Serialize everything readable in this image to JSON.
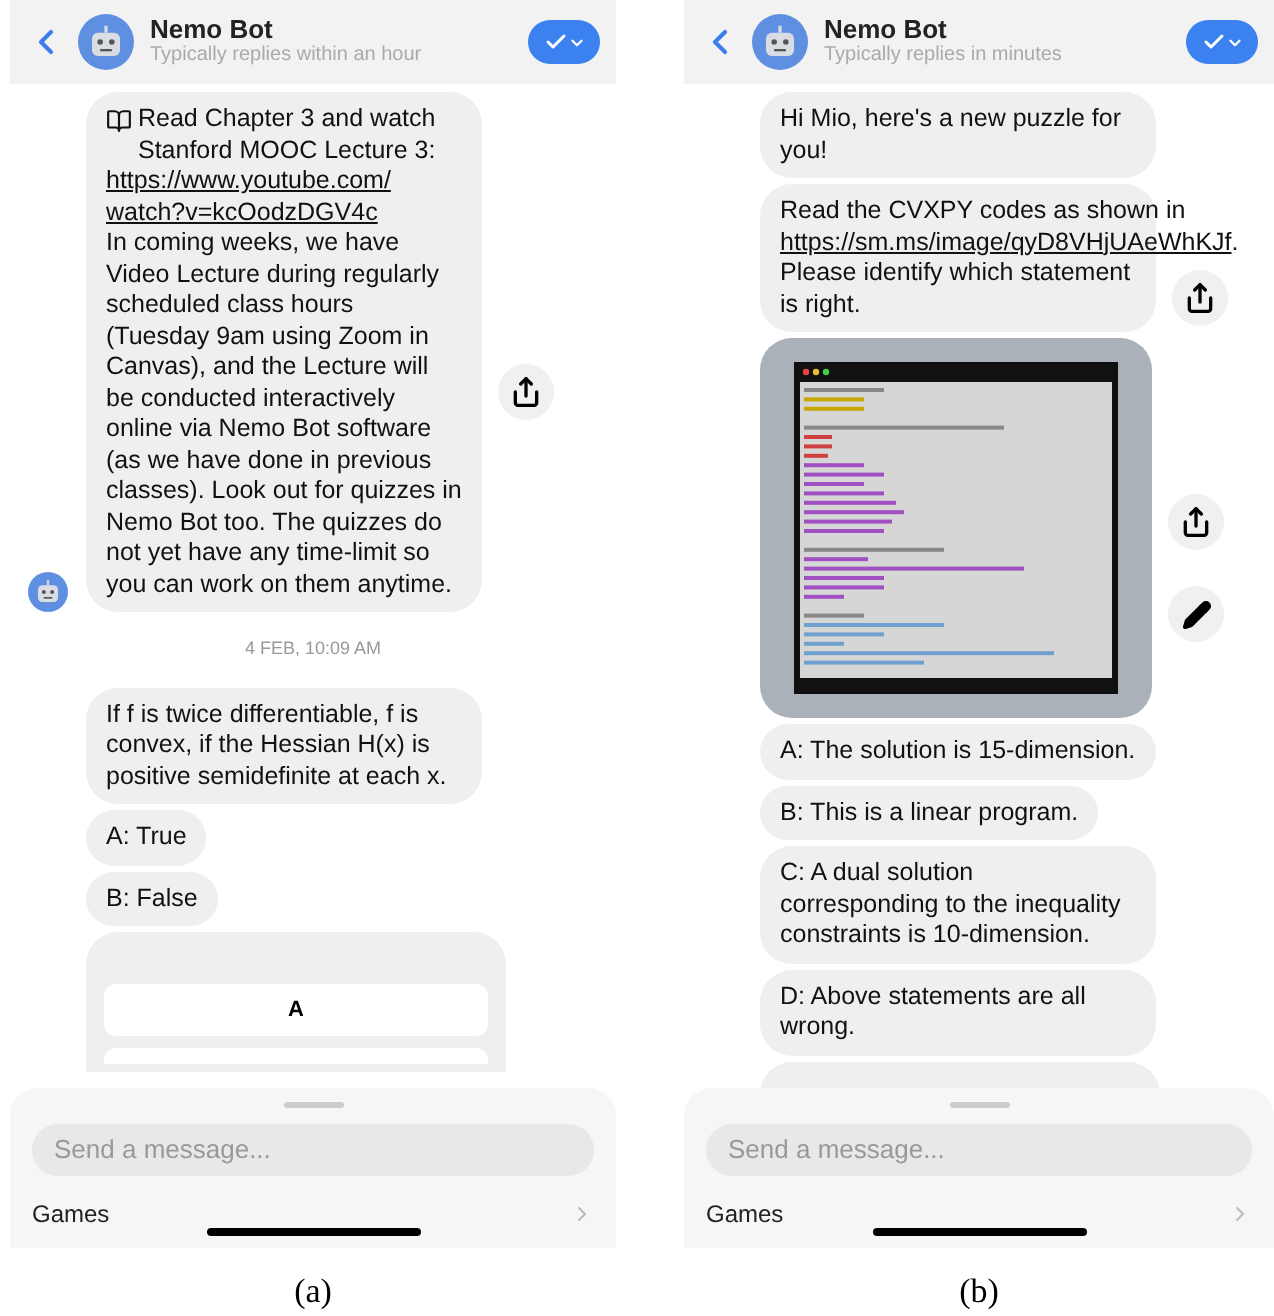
{
  "panels": [
    {
      "caption": "(a)",
      "header": {
        "title": "Nemo Bot",
        "subtitle": "Typically replies within an hour"
      },
      "messages": [
        {
          "kind": "announcement",
          "paragraphs": [
            [
              {
                "kind": "text",
                "text": "Read Chapter 3 and watch Stanford MOOC Lecture 3:"
              }
            ],
            [
              {
                "kind": "link",
                "text": "https://www.youtube.com/"
              }
            ],
            [
              {
                "kind": "link",
                "text": "watch?v=kcOodzDGV4c"
              }
            ],
            [
              {
                "kind": "text",
                "text": "In coming weeks, we have Video Lecture during regularly scheduled class hours (Tuesday 9am using Zoom in Canvas), and the Lecture will be conducted interactively online via Nemo Bot software (as we have done in previous classes). Look out for quizzes in Nemo Bot too. The quizzes do not yet have any time-limit so you can work on them anytime."
              }
            ]
          ]
        },
        {
          "kind": "timestamp",
          "text": "4 FEB, 10:09 AM"
        },
        {
          "kind": "text",
          "paragraphs": [
            [
              {
                "kind": "text",
                "text": "If f is twice differentiable, f is convex, if the Hessian H(x) is positive semidefinite at each x."
              }
            ]
          ]
        },
        {
          "kind": "text",
          "paragraphs": [
            [
              {
                "kind": "text",
                "text": "A: True"
              }
            ]
          ]
        },
        {
          "kind": "text",
          "paragraphs": [
            [
              {
                "kind": "text",
                "text": "B: False"
              }
            ]
          ]
        },
        {
          "kind": "options",
          "buttons": [
            {
              "label": "A"
            }
          ]
        }
      ],
      "composer": {
        "placeholder": "Send a message...",
        "menu_label": "Games"
      }
    },
    {
      "caption": "(b)",
      "header": {
        "title": "Nemo Bot",
        "subtitle": "Typically replies in minutes"
      },
      "messages": [
        {
          "kind": "text",
          "paragraphs": [
            [
              {
                "kind": "text",
                "text": "Hi Mio, here's a new puzzle for you!"
              }
            ]
          ]
        },
        {
          "kind": "shareable",
          "paragraphs": [
            [
              {
                "kind": "text",
                "text": "Read the CVXPY codes as shown in "
              },
              {
                "kind": "link",
                "text": "https://sm.ms/image/"
              },
              {
                "kind": "link",
                "text": "qyD8VHjUAeWhKJf"
              },
              {
                "kind": "text",
                "text": "."
              }
            ],
            [
              {
                "kind": "text",
                "text": "Please identify which statement is right."
              }
            ]
          ]
        },
        {
          "kind": "image"
        },
        {
          "kind": "text",
          "paragraphs": [
            [
              {
                "kind": "text",
                "text": "A: The solution is 15-dimension."
              }
            ]
          ]
        },
        {
          "kind": "text",
          "paragraphs": [
            [
              {
                "kind": "text",
                "text": "B: This is a linear program."
              }
            ]
          ]
        },
        {
          "kind": "text",
          "paragraphs": [
            [
              {
                "kind": "text",
                "text": "C: A dual solution corresponding to the inequality constraints is 10-dimension."
              }
            ]
          ]
        },
        {
          "kind": "text",
          "paragraphs": [
            [
              {
                "kind": "text",
                "text": "D: Above statements are all wrong."
              }
            ]
          ]
        },
        {
          "kind": "cut"
        }
      ],
      "composer": {
        "placeholder": "Send a message...",
        "menu_label": "Games"
      }
    }
  ]
}
